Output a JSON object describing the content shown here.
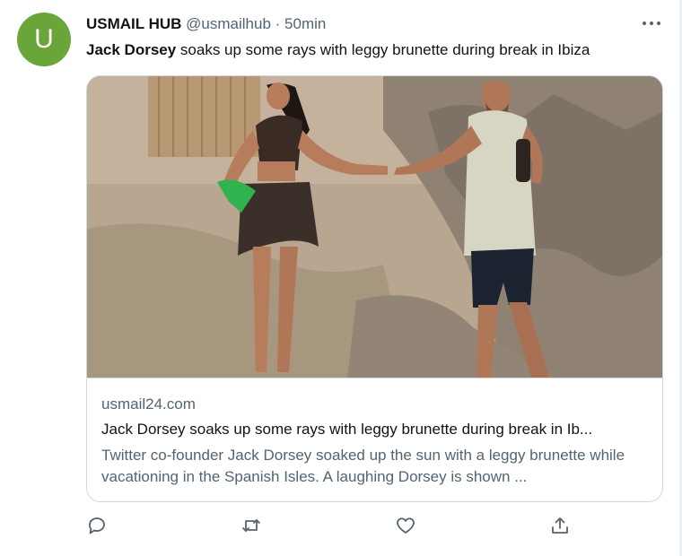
{
  "tweet": {
    "avatar_letter": "U",
    "avatar_color": "#6aa53a",
    "display_name": "USMAIL HUB",
    "handle": "@usmailhub",
    "separator": "·",
    "time": "50min",
    "text_bold": "Jack Dorsey",
    "text_rest": " soaks up some rays with leggy brunette during break in Ibiza"
  },
  "card": {
    "domain": "usmail24.com",
    "title": "Jack Dorsey soaks up some rays with leggy brunette during break in Ib...",
    "description": "Twitter co-founder Jack Dorsey soaked up the sun with a leggy brunette while vacationing in the Spanish Isles. A laughing Dorsey is shown ..."
  },
  "actions": {
    "icons": [
      "reply-icon",
      "retweet-icon",
      "like-icon",
      "share-icon"
    ]
  },
  "colors": {
    "text_primary": "#0f1419",
    "text_secondary": "#536471",
    "border": "#cfd9de"
  }
}
